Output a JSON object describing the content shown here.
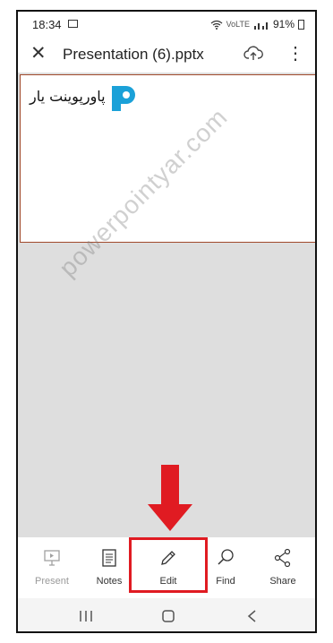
{
  "status": {
    "time": "18:34",
    "battery": "91%",
    "signal_label": "Vo))\nLTE1"
  },
  "appbar": {
    "title": "Presentation (6).pptx"
  },
  "slide": {
    "logo_text": "پاورپوینت یار"
  },
  "watermark": "powerpointyar.com",
  "toolbar": {
    "present": "Present",
    "notes": "Notes",
    "edit": "Edit",
    "find": "Find",
    "share": "Share"
  },
  "colors": {
    "accent": "#e01b22",
    "slide_border": "#a04a2c",
    "logo_blue": "#1ba1d8"
  }
}
